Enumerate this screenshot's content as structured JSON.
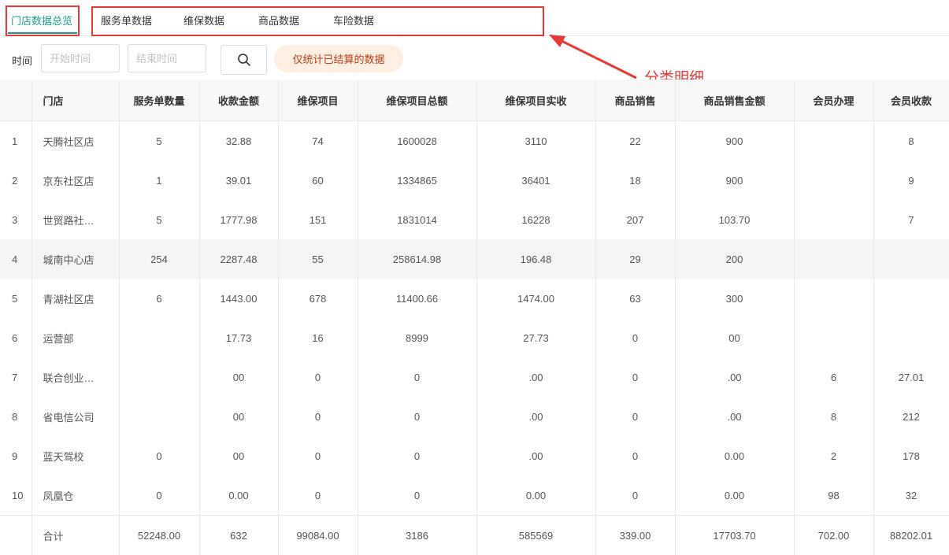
{
  "tabs": [
    {
      "label": "门店数据总览",
      "active": true
    },
    {
      "label": "服务单数据",
      "active": false
    },
    {
      "label": "维保数据",
      "active": false
    },
    {
      "label": "商品数据",
      "active": false
    },
    {
      "label": "车险数据",
      "active": false
    }
  ],
  "annotation": {
    "text": "分类明细",
    "color": "#e53935"
  },
  "filter": {
    "time_label": "时间",
    "start_placeholder": "开始时间",
    "end_placeholder": "结束时间",
    "search_icon": "search-icon",
    "notice": "仅统计已结算的数据"
  },
  "colors": {
    "accent": "#1a9c8c",
    "notice_bg": "#fdf0e2",
    "notice_text": "#b83c16"
  },
  "table": {
    "columns": [
      "",
      "门店",
      "服务单数量",
      "收款金额",
      "维保项目",
      "维保项目总额",
      "维保项目实收",
      "商品销售",
      "商品销售金额",
      "会员办理",
      "会员收款"
    ],
    "rows": [
      [
        "1",
        "天腾社区店",
        "5",
        "32.88",
        "74",
        "1600028",
        "3110",
        "22",
        "900",
        "",
        "8"
      ],
      [
        "2",
        "京东社区店",
        "1",
        "39.01",
        "60",
        "1334865",
        "36401",
        "18",
        "900",
        "",
        "9"
      ],
      [
        "3",
        "世贸路社…",
        "5",
        "1777.98",
        "151",
        "1831014",
        "16228",
        "207",
        "103.70",
        "",
        "7"
      ],
      [
        "4",
        "城南中心店",
        "254",
        "2287.48",
        "55",
        "258614.98",
        "196.48",
        "29",
        "200",
        "",
        ""
      ],
      [
        "5",
        "青湖社区店",
        "6",
        "1443.00",
        "678",
        "11400.66",
        "1474.00",
        "63",
        "300",
        "",
        ""
      ],
      [
        "6",
        "运营部",
        "",
        "17.73",
        "16",
        "8999",
        "27.73",
        "0",
        "00",
        "",
        ""
      ],
      [
        "7",
        "联合创业…",
        "",
        "00",
        "0",
        "0",
        ".00",
        "0",
        ".00",
        "6",
        "27.01"
      ],
      [
        "8",
        "省电信公司",
        "",
        "00",
        "0",
        "0",
        ".00",
        "0",
        ".00",
        "8",
        "212"
      ],
      [
        "9",
        "蓝天驾校",
        "0",
        "00",
        "0",
        "0",
        ".00",
        "0",
        "0.00",
        "2",
        "178"
      ],
      [
        "10",
        "凤凰仓",
        "0",
        "0.00",
        "0",
        "0",
        "0.00",
        "0",
        "0.00",
        "98",
        "32"
      ]
    ],
    "total": [
      "",
      "合计",
      "52248.00",
      "632",
      "99084.00",
      "3186",
      "585569",
      "339.00",
      "17703.70",
      "702.00",
      "88202.01"
    ]
  }
}
